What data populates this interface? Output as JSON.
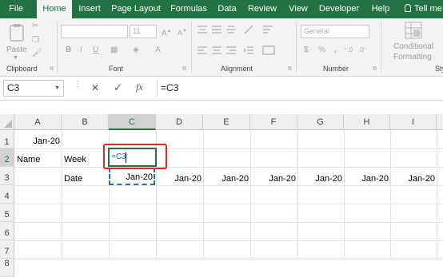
{
  "menu": {
    "tabs": [
      "File",
      "Home",
      "Insert",
      "Page Layout",
      "Formulas",
      "Data",
      "Review",
      "View",
      "Developer",
      "Help",
      "Tell me"
    ],
    "active": "Home"
  },
  "ribbon": {
    "paste_label": "Paste",
    "font_size": "11",
    "number_format": "General",
    "conditional_formatting_label1": "Conditional",
    "conditional_formatting_label2": "Formatting",
    "groups": {
      "clipboard": "Clipboard",
      "font": "Font",
      "alignment": "Alignment",
      "number": "Number",
      "styles": "Sty"
    },
    "percent_symbol": "%",
    "comma_symbol": ",",
    "bold": "B",
    "italic": "I",
    "underline": "U"
  },
  "formula_bar": {
    "name_box": "C3",
    "cancel_symbol": "✕",
    "enter_symbol": "✓",
    "fx_symbol": "fx",
    "content": "=C3"
  },
  "sheet": {
    "columns": [
      "A",
      "B",
      "C",
      "D",
      "E",
      "F",
      "G",
      "H",
      "I"
    ],
    "rows": [
      "1",
      "2",
      "3",
      "4",
      "5",
      "6",
      "7",
      "8"
    ],
    "selected_column": "C",
    "selected_row": "2",
    "cells": {
      "A1": "Jan-20",
      "A2": "Name",
      "B2": "Week",
      "C2": "=C3",
      "B3": "Date",
      "C3": "Jan-20",
      "D3": "Jan-20",
      "E3": "Jan-20",
      "F3": "Jan-20",
      "G3": "Jan-20",
      "H3": "Jan-20",
      "I3": "Jan-20"
    }
  },
  "colors": {
    "brand": "#217346",
    "highlight_box": "#e0281e",
    "formula_ref": "#1e6ad2"
  }
}
